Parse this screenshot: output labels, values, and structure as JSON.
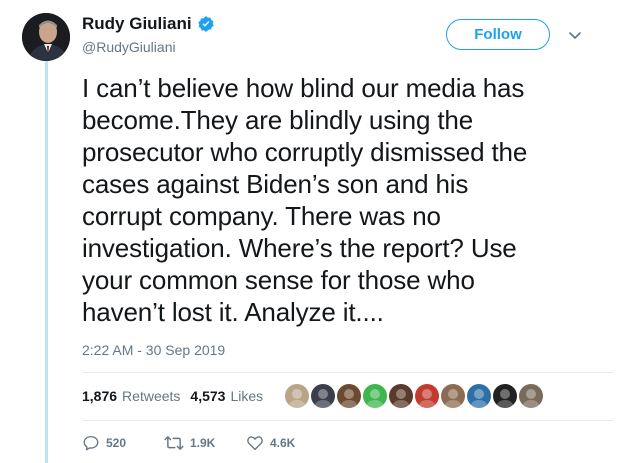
{
  "user": {
    "display_name": "Rudy Giuliani",
    "handle": "@RudyGiuliani",
    "verified": true
  },
  "header": {
    "follow_label": "Follow"
  },
  "tweet": {
    "text": "I can’t believe how blind our media has\nbecome.They are blindly using the\nprosecutor who corruptly dismissed the\ncases against Biden’s son and his\ncorrupt company. There was no\ninvestigation. Where’s the report? Use\nyour common sense for those who\nhaven’t lost it. Analyze it....",
    "timestamp": "2:22 AM - 30 Sep 2019"
  },
  "stats": {
    "retweets_count": "1,876",
    "retweets_label": "Retweets",
    "likes_count": "4,573",
    "likes_label": "Likes"
  },
  "likers": [
    {
      "icon": "dog-avatar",
      "color": "#b9a48a"
    },
    {
      "icon": "avatar",
      "color": "#3b3f4a"
    },
    {
      "icon": "avatar",
      "color": "#6b4a2f"
    },
    {
      "icon": "avatar",
      "color": "#3fb54f"
    },
    {
      "icon": "avatar",
      "color": "#5a3a2a"
    },
    {
      "icon": "avatar",
      "color": "#c23b2e"
    },
    {
      "icon": "avatar",
      "color": "#8b6b52"
    },
    {
      "icon": "avatar",
      "color": "#2f6fa8"
    },
    {
      "icon": "avatar",
      "color": "#222222"
    },
    {
      "icon": "avatar",
      "color": "#7a6a5a"
    }
  ],
  "actions": {
    "replies": "520",
    "retweets": "1.9K",
    "likes": "4.6K"
  },
  "colors": {
    "accent": "#1da1f2",
    "secondary_text": "#657786",
    "thread_line": "#bfe3f5"
  }
}
